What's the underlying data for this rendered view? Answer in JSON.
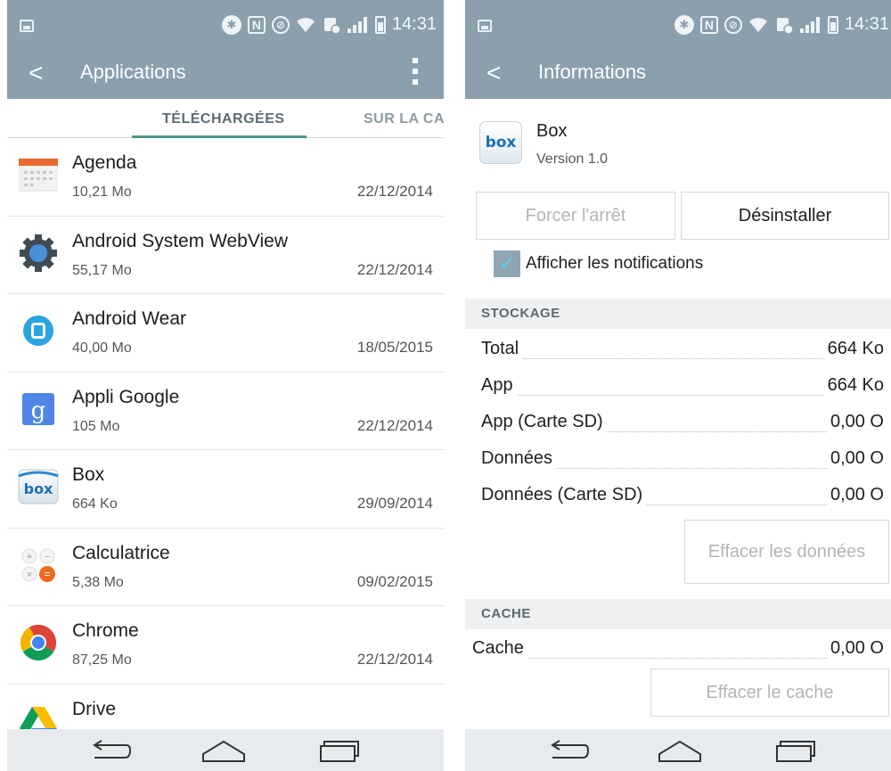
{
  "status": {
    "time": "14:31"
  },
  "left": {
    "title": "Applications",
    "tab_active": "TÉLÉCHARGÉES",
    "tab_other": "SUR LA CA",
    "apps": [
      {
        "name": "Agenda",
        "size": "10,21 Mo",
        "date": "22/12/2014",
        "icon": "calendar-icon"
      },
      {
        "name": "Android System WebView",
        "size": "55,17 Mo",
        "date": "22/12/2014",
        "icon": "gear-icon"
      },
      {
        "name": "Android Wear",
        "size": "40,00 Mo",
        "date": "18/05/2015",
        "icon": "android-wear-icon"
      },
      {
        "name": "Appli Google",
        "size": "105 Mo",
        "date": "22/12/2014",
        "icon": "google-icon"
      },
      {
        "name": "Box",
        "size": "664 Ko",
        "date": "29/09/2014",
        "icon": "box-icon"
      },
      {
        "name": "Calculatrice",
        "size": "5,38 Mo",
        "date": "09/02/2015",
        "icon": "calculator-icon"
      },
      {
        "name": "Chrome",
        "size": "87,25 Mo",
        "date": "22/12/2014",
        "icon": "chrome-icon"
      },
      {
        "name": "Drive",
        "size": "",
        "date": "",
        "icon": "drive-icon"
      }
    ]
  },
  "right": {
    "title": "Informations",
    "app_name": "Box",
    "app_version": "Version 1.0",
    "box_logo_text": "box",
    "force_stop": "Forcer l'arrêt",
    "uninstall": "Désinstaller",
    "show_notifications": "Afficher les notifications",
    "storage_header": "STOCKAGE",
    "storage": [
      {
        "label": "Total",
        "value": "664  Ko"
      },
      {
        "label": "App",
        "value": "664  Ko"
      },
      {
        "label": "App (Carte SD)",
        "value": "0,00  O"
      },
      {
        "label": "Données",
        "value": "0,00  O"
      },
      {
        "label": "Données (Carte SD)",
        "value": "0,00  O"
      }
    ],
    "clear_data": "Effacer les données",
    "cache_header": "CACHE",
    "cache_label": "Cache",
    "cache_value": "0,00  O",
    "clear_cache": "Effacer le cache"
  },
  "colors": {
    "bar": "#8b9fad",
    "tab_indicator": "#4e9788",
    "section_bg": "#eef0f2",
    "nav_bg": "#e8ebed"
  }
}
